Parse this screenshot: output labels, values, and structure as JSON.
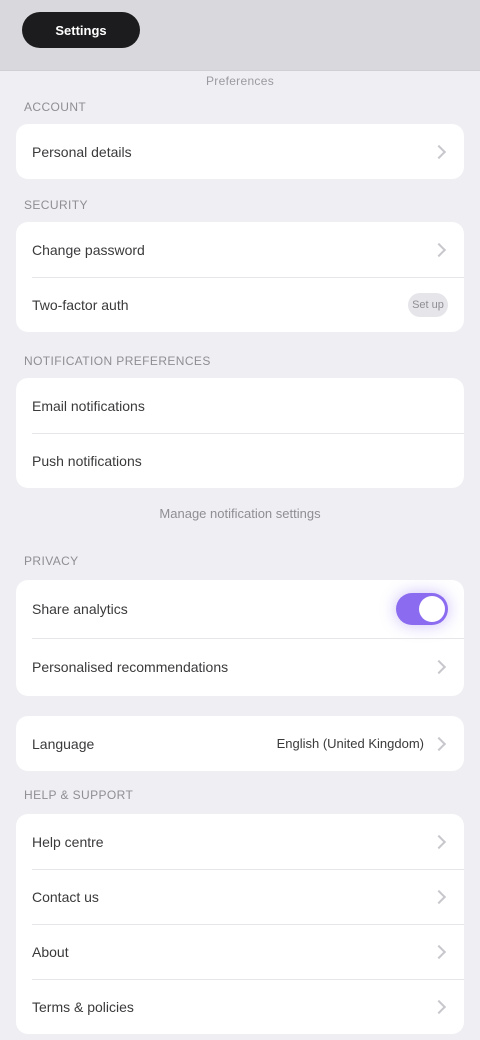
{
  "header": {
    "back_label": "Settings",
    "title": "Preferences"
  },
  "sections": {
    "account": {
      "header": "Account",
      "rows": [
        {
          "label": "Personal details"
        }
      ]
    },
    "security": {
      "header": "Security",
      "rows": [
        {
          "label": "Change password"
        },
        {
          "label": "Two-factor auth",
          "action": "Set up"
        }
      ]
    },
    "notifications": {
      "header": "Notification preferences",
      "rows": [
        {
          "label": "Email notifications"
        },
        {
          "label": "Push notifications"
        }
      ],
      "footer_link": "Manage notification settings"
    },
    "privacy": {
      "header": "Privacy",
      "rows": [
        {
          "label": "Share analytics",
          "toggle_on": true
        },
        {
          "label": "Personalised recommendations"
        }
      ]
    },
    "language": {
      "label": "Language",
      "value": "English (United Kingdom)"
    },
    "support": {
      "header": "Help & support",
      "rows": [
        {
          "label": "Help centre"
        },
        {
          "label": "Contact us"
        },
        {
          "label": "About"
        },
        {
          "label": "Terms & policies"
        }
      ]
    }
  },
  "colors": {
    "accent": "#8b6cf0",
    "background": "#eeeef3"
  }
}
